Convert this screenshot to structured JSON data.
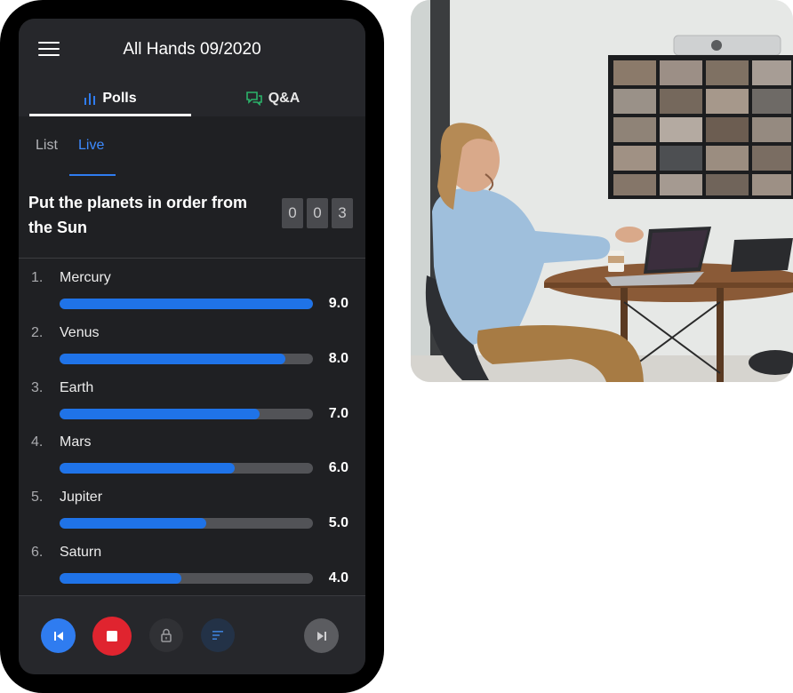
{
  "header": {
    "title": "All Hands 09/2020",
    "menu_icon": "hamburger-menu-icon"
  },
  "tabs": [
    {
      "label": "Polls",
      "icon": "bar-chart-icon",
      "icon_color": "#2f7cf0",
      "active": true
    },
    {
      "label": "Q&A",
      "icon": "chat-bubbles-icon",
      "icon_color": "#2bb36a",
      "active": false
    }
  ],
  "subtabs": [
    {
      "label": "List",
      "active": false
    },
    {
      "label": "Live",
      "active": true
    }
  ],
  "question": {
    "text": "Put the planets in order from the Sun",
    "counter": [
      "0",
      "0",
      "3"
    ]
  },
  "answers": [
    {
      "num": "1.",
      "name": "Mercury",
      "score": "9.0",
      "fill": 1.0
    },
    {
      "num": "2.",
      "name": "Venus",
      "score": "8.0",
      "fill": 0.89
    },
    {
      "num": "3.",
      "name": "Earth",
      "score": "7.0",
      "fill": 0.79
    },
    {
      "num": "4.",
      "name": "Mars",
      "score": "6.0",
      "fill": 0.69
    },
    {
      "num": "5.",
      "name": "Jupiter",
      "score": "5.0",
      "fill": 0.58
    },
    {
      "num": "6.",
      "name": "Saturn",
      "score": "4.0",
      "fill": 0.48
    }
  ],
  "controls": [
    {
      "name": "previous-button",
      "icon": "skip-previous-icon",
      "color": "#2f7cf0"
    },
    {
      "name": "stop-button",
      "icon": "stop-icon",
      "color": "#e0242f"
    },
    {
      "name": "lock-button",
      "icon": "lock-icon",
      "color": "#303135"
    },
    {
      "name": "sort-button",
      "icon": "sort-icon",
      "color": "#233247"
    },
    {
      "name": "next-button",
      "icon": "skip-next-icon",
      "color": "#5b5c60"
    }
  ],
  "colors": {
    "accent": "#2f7cf0",
    "bar_fill": "#1f73e8",
    "stop": "#e0242f"
  }
}
